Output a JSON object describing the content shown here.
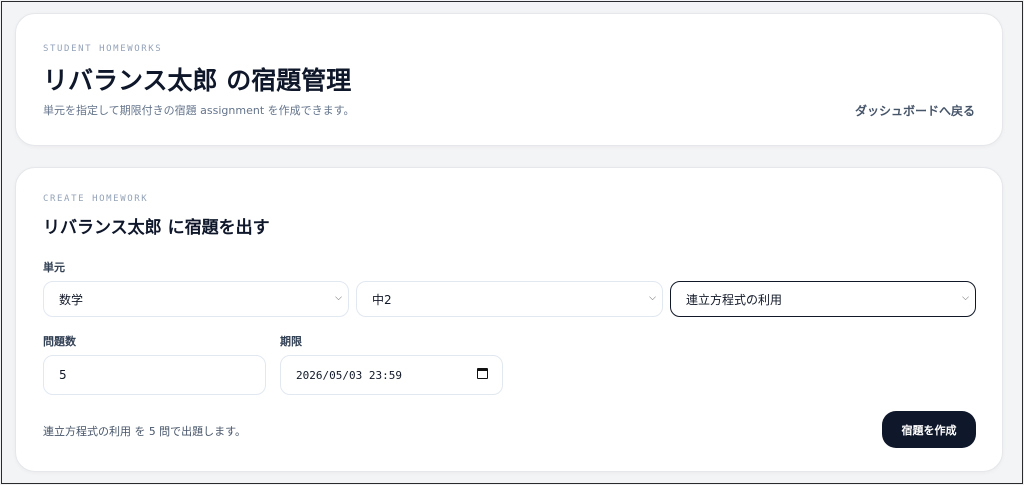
{
  "header": {
    "eyebrow": "STUDENT HOMEWORKS",
    "title": "リバランス太郎 の宿題管理",
    "description": "単元を指定して期限付きの宿題 assignment を作成できます。",
    "back_link": "ダッシュボードへ戻る"
  },
  "create": {
    "eyebrow": "CREATE HOMEWORK",
    "title": "リバランス太郎 に宿題を出す",
    "unit_label": "単元",
    "subject_select": "数学",
    "grade_select": "中2",
    "topic_select": "連立方程式の利用",
    "count_label": "問題数",
    "count_value": "5",
    "deadline_label": "期限",
    "deadline_value": "2026/05/03 23:59",
    "summary": {
      "topic": "連立方程式の利用",
      "mid1": " を ",
      "count": "5",
      "mid2": " 問で出題します。"
    },
    "submit_label": "宿題を作成"
  },
  "colors": {
    "page_bg": "#f3f4f6",
    "card_bg": "#ffffff",
    "primary_button": "#0f172a",
    "muted_text": "#64748b"
  },
  "icons": {
    "select_chevron": "chevron-down-icon",
    "date_picker": "calendar-icon"
  }
}
